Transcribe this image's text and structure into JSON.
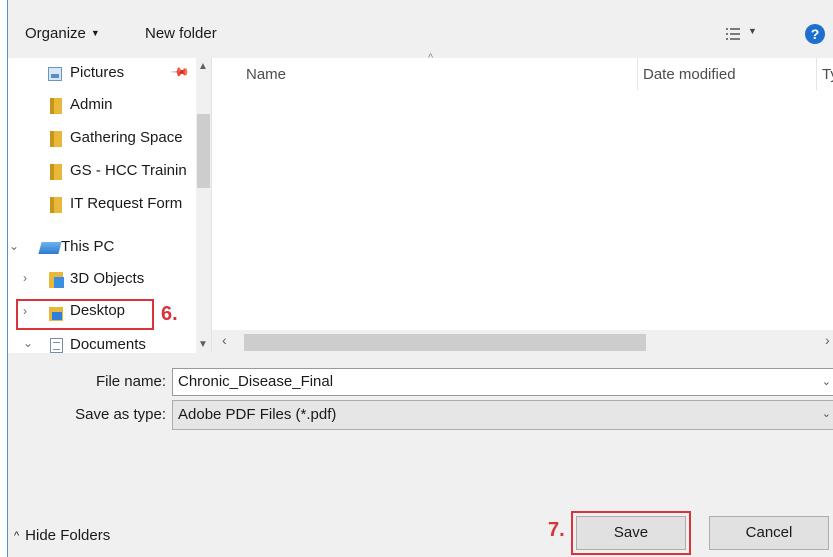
{
  "toolbar": {
    "organize_label": "Organize",
    "new_folder_label": "New folder",
    "help_label": "?"
  },
  "nav": {
    "items": [
      {
        "label": "Pictures",
        "icon": "pictures-icon",
        "pinned": true
      },
      {
        "label": "Admin",
        "icon": "folder-icon"
      },
      {
        "label": "Gathering Space",
        "icon": "folder-icon"
      },
      {
        "label": "GS - HCC Trainin",
        "icon": "folder-icon"
      },
      {
        "label": "IT Request Form",
        "icon": "folder-icon"
      },
      {
        "label": "This PC",
        "icon": "computer-icon",
        "expanded": true
      },
      {
        "label": "3D Objects",
        "icon": "3d-objects-icon"
      },
      {
        "label": "Desktop",
        "icon": "desktop-icon",
        "highlighted": true
      },
      {
        "label": "Documents",
        "icon": "documents-icon",
        "expanded": true
      }
    ]
  },
  "annotations": {
    "step_desktop": "6.",
    "step_save": "7."
  },
  "file_list": {
    "columns": [
      "Name",
      "Date modified",
      "Ty"
    ],
    "sort_column": "Name"
  },
  "form": {
    "file_name_label": "File name:",
    "file_name_value": "Chronic_Disease_Final",
    "save_as_type_label": "Save as type:",
    "save_as_type_value": "Adobe PDF Files (*.pdf)"
  },
  "footer": {
    "hide_folders_label": "Hide Folders",
    "save_label": "Save",
    "cancel_label": "Cancel"
  },
  "colors": {
    "accent": "#1f6fd1",
    "annotation_red": "#d9343b",
    "folder_yellow": "#e7b83a"
  }
}
